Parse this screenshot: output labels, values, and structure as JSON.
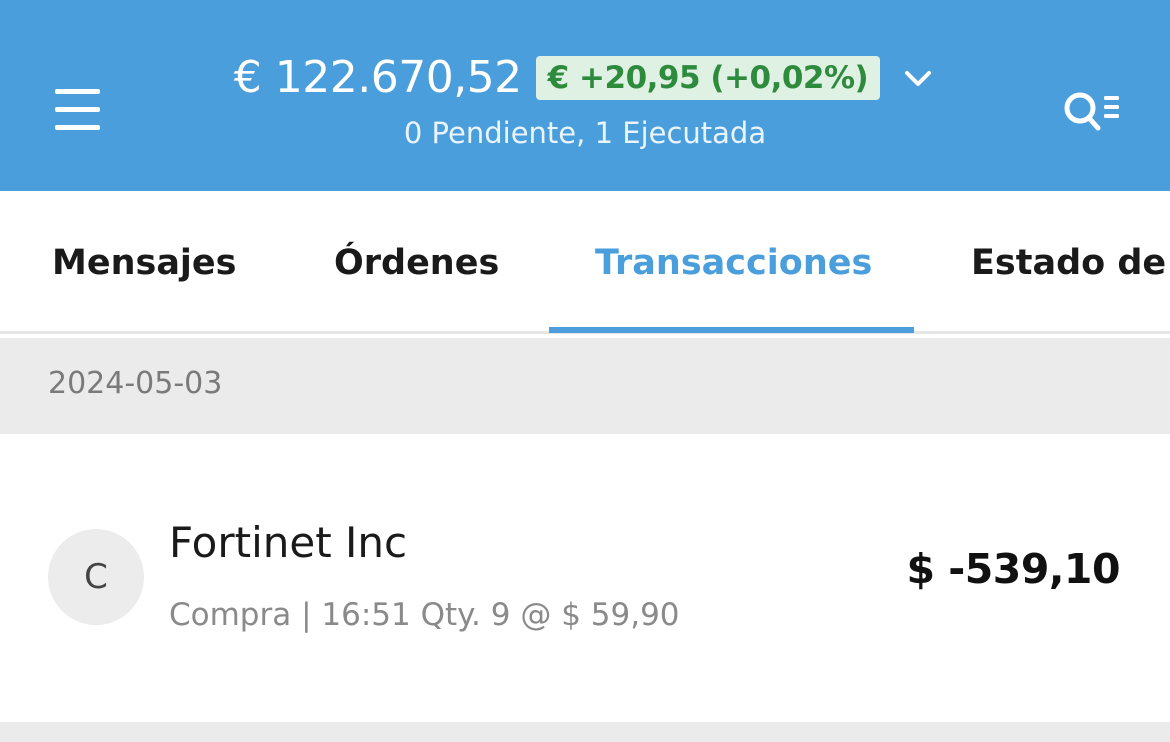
{
  "header": {
    "balance": "€ 122.670,52",
    "change": "€ +20,95 (+0,02%)",
    "status": "0 Pendiente, 1 Ejecutada",
    "icons": {
      "menu": "hamburger-menu-icon",
      "dropdown": "chevron-down-icon",
      "search": "search-list-icon"
    }
  },
  "tabs": [
    {
      "label": "Mensajes",
      "active": false
    },
    {
      "label": "Órdenes",
      "active": false
    },
    {
      "label": "Transacciones",
      "active": true
    },
    {
      "label": "Estado de c",
      "active": false
    }
  ],
  "transactions": {
    "date": "2024-05-03",
    "items": [
      {
        "avatar_letter": "C",
        "name": "Fortinet Inc",
        "detail": "Compra | 16:51 Qty. 9 @ $ 59,90",
        "amount": "$ -539,10"
      }
    ]
  },
  "colors": {
    "brand": "#4a9edb",
    "positive": "#2e8b3e",
    "positive_bg": "#dff1e3",
    "section_bg": "#ebebeb"
  }
}
